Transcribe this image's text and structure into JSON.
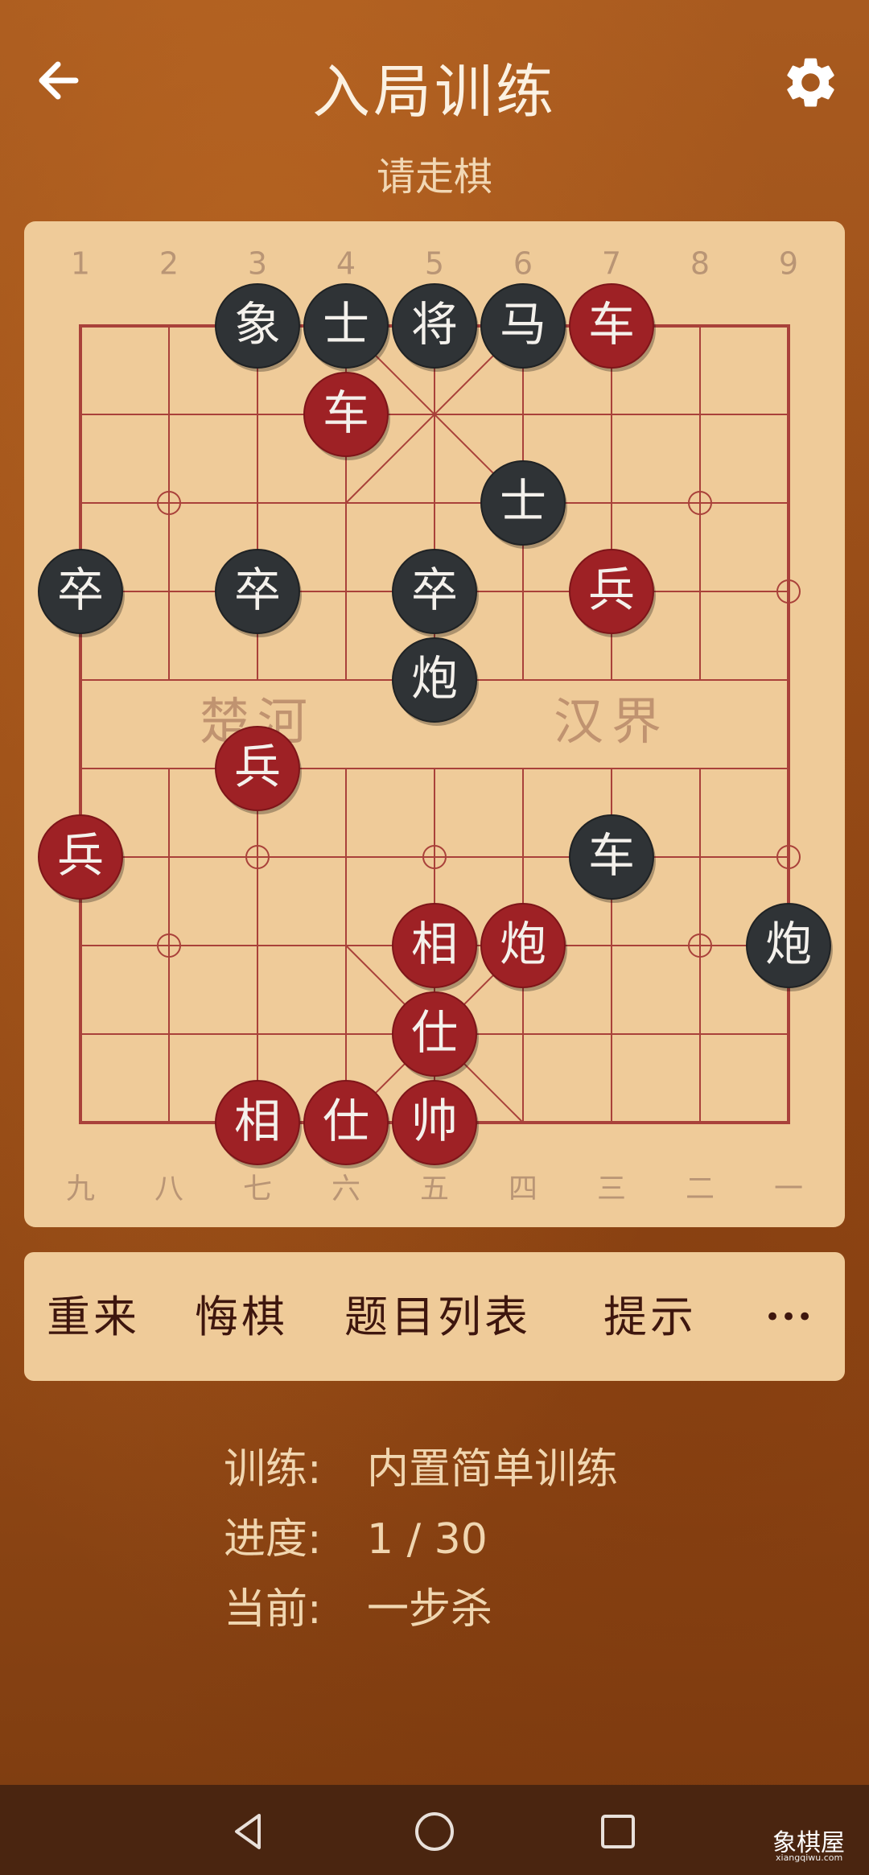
{
  "header": {
    "title": "入局训练",
    "subtitle": "请走棋"
  },
  "board": {
    "top_labels": [
      "1",
      "2",
      "3",
      "4",
      "5",
      "6",
      "7",
      "8",
      "9"
    ],
    "bottom_labels": [
      "九",
      "八",
      "七",
      "六",
      "五",
      "四",
      "三",
      "二",
      "一"
    ],
    "river_left": "楚河",
    "river_right": "汉界",
    "pieces": [
      {
        "side": "black",
        "char": "象",
        "file": 3,
        "rank": 0
      },
      {
        "side": "black",
        "char": "士",
        "file": 4,
        "rank": 0
      },
      {
        "side": "black",
        "char": "将",
        "file": 5,
        "rank": 0
      },
      {
        "side": "black",
        "char": "马",
        "file": 6,
        "rank": 0
      },
      {
        "side": "red",
        "char": "车",
        "file": 7,
        "rank": 0
      },
      {
        "side": "red",
        "char": "车",
        "file": 4,
        "rank": 1
      },
      {
        "side": "black",
        "char": "士",
        "file": 6,
        "rank": 2
      },
      {
        "side": "black",
        "char": "卒",
        "file": 1,
        "rank": 3
      },
      {
        "side": "black",
        "char": "卒",
        "file": 3,
        "rank": 3
      },
      {
        "side": "black",
        "char": "卒",
        "file": 5,
        "rank": 3
      },
      {
        "side": "red",
        "char": "兵",
        "file": 7,
        "rank": 3
      },
      {
        "side": "black",
        "char": "炮",
        "file": 5,
        "rank": 4
      },
      {
        "side": "red",
        "char": "兵",
        "file": 3,
        "rank": 5
      },
      {
        "side": "red",
        "char": "兵",
        "file": 1,
        "rank": 6
      },
      {
        "side": "black",
        "char": "车",
        "file": 7,
        "rank": 6
      },
      {
        "side": "red",
        "char": "相",
        "file": 5,
        "rank": 7
      },
      {
        "side": "red",
        "char": "炮",
        "file": 6,
        "rank": 7
      },
      {
        "side": "black",
        "char": "炮",
        "file": 9,
        "rank": 7
      },
      {
        "side": "red",
        "char": "仕",
        "file": 5,
        "rank": 8
      },
      {
        "side": "red",
        "char": "相",
        "file": 3,
        "rank": 9
      },
      {
        "side": "red",
        "char": "仕",
        "file": 4,
        "rank": 9
      },
      {
        "side": "red",
        "char": "帅",
        "file": 5,
        "rank": 9
      }
    ]
  },
  "actions": {
    "restart": "重来",
    "undo": "悔棋",
    "list": "题目列表",
    "hint": "提示",
    "more": "•••"
  },
  "info": {
    "training_label": "训练:",
    "training_value": "内置简单训练",
    "progress_label": "进度:",
    "progress_value": "1 / 30",
    "current_label": "当前:",
    "current_value": "一步杀"
  },
  "watermark": {
    "text": "象棋屋",
    "sub": "xiangqiwu.com"
  },
  "icons": {
    "back": "arrow-left-icon",
    "settings": "gear-icon",
    "nav_back": "triangle-back-icon",
    "nav_home": "circle-home-icon",
    "nav_recent": "square-recent-icon"
  },
  "colors": {
    "red_piece": "#9e2125",
    "black_piece": "#2f3336",
    "board": "#efcb99",
    "grid": "#a9413a"
  }
}
